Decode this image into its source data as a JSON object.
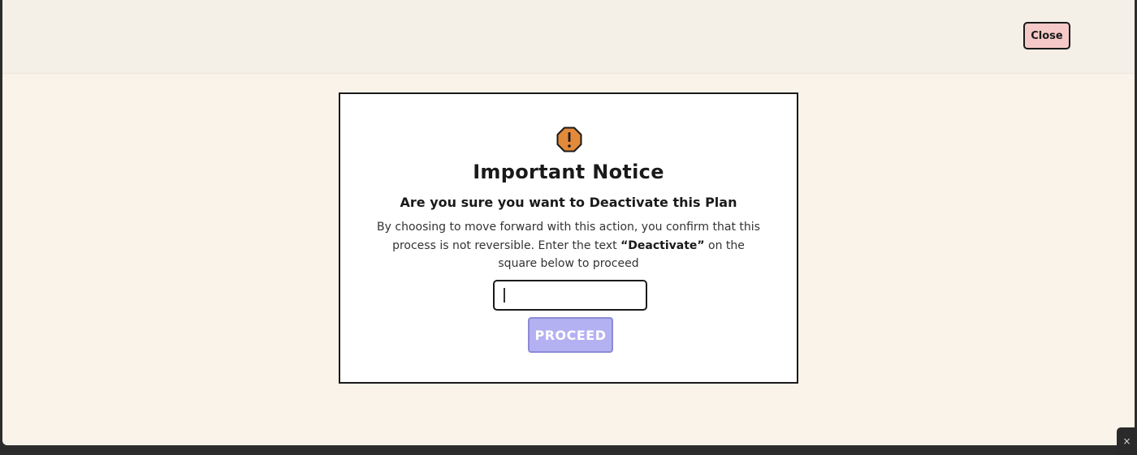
{
  "header": {
    "close_label": "Close"
  },
  "modal": {
    "icon": "warning-octagon-icon",
    "title": "Important Notice",
    "subtitle": "Are you sure you want to Deactivate this Plan",
    "body_before": "By choosing to move forward with this action, you confirm that this process is not reversible. Enter the text ",
    "body_keyword": "“Deactivate”",
    "body_after": " on the square below to proceed",
    "input_value": "",
    "input_placeholder": "",
    "proceed_label": "PROCEED"
  },
  "overlay": {
    "mini_close_glyph": "×"
  },
  "colors": {
    "page_bg": "#faf3e9",
    "topbar_bg": "#f4efe7",
    "close_button_bg": "#f6c9c9",
    "warning_orange": "#e38a3a",
    "proceed_disabled": "#b4b1f2"
  }
}
